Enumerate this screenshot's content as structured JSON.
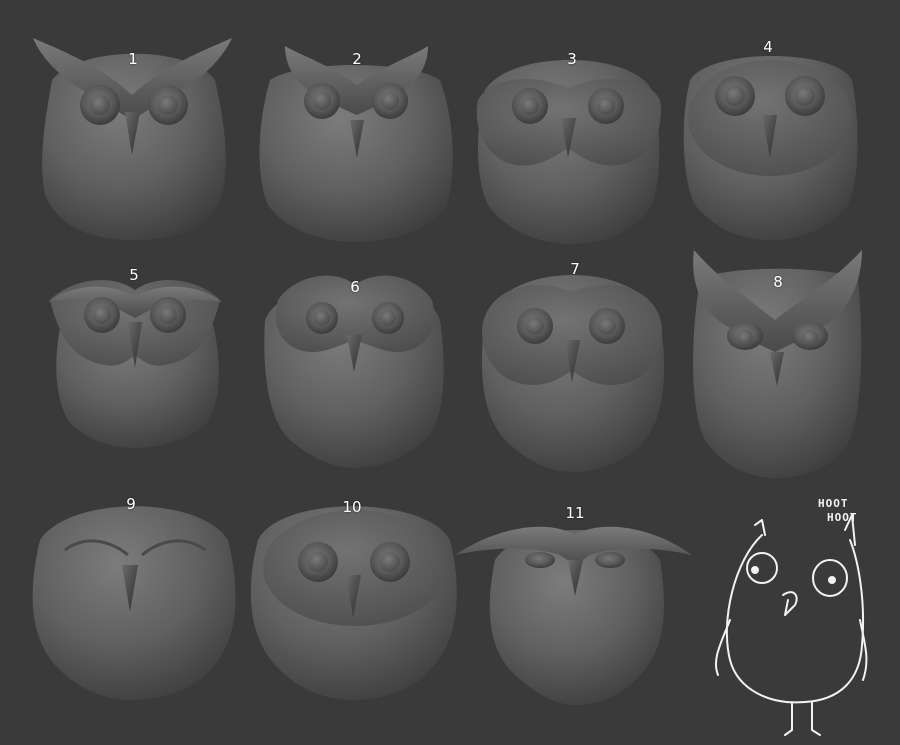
{
  "background_color": "#3a3a3a",
  "owl_color": "#6b6b6b",
  "owls": [
    {
      "label": "1"
    },
    {
      "label": "2"
    },
    {
      "label": "3"
    },
    {
      "label": "4"
    },
    {
      "label": "5"
    },
    {
      "label": "6"
    },
    {
      "label": "7"
    },
    {
      "label": "8"
    },
    {
      "label": "9"
    },
    {
      "label": "10"
    },
    {
      "label": "11"
    }
  ],
  "sketch": {
    "line1": "HOOT",
    "line2": "HOOT"
  }
}
